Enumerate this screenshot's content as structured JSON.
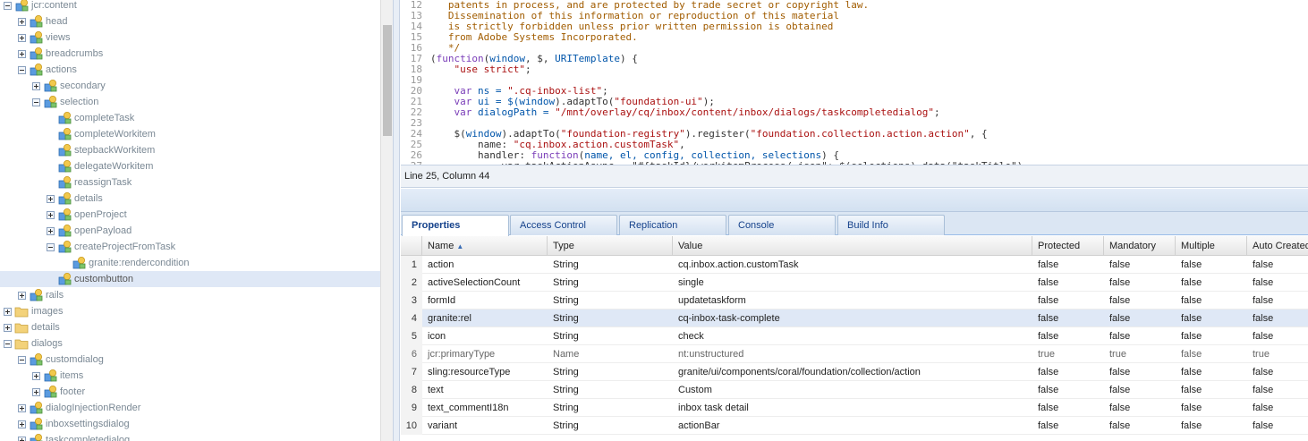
{
  "tree": {
    "nodes": [
      {
        "label": "jcr:content",
        "depth": 0,
        "expander": "minus",
        "icon": "node"
      },
      {
        "label": "head",
        "depth": 1,
        "expander": "plus",
        "icon": "node"
      },
      {
        "label": "views",
        "depth": 1,
        "expander": "plus",
        "icon": "node"
      },
      {
        "label": "breadcrumbs",
        "depth": 1,
        "expander": "plus",
        "icon": "node"
      },
      {
        "label": "actions",
        "depth": 1,
        "expander": "minus",
        "icon": "node"
      },
      {
        "label": "secondary",
        "depth": 2,
        "expander": "plus",
        "icon": "node"
      },
      {
        "label": "selection",
        "depth": 2,
        "expander": "minus",
        "icon": "node"
      },
      {
        "label": "completeTask",
        "depth": 3,
        "expander": "none",
        "icon": "node"
      },
      {
        "label": "completeWorkitem",
        "depth": 3,
        "expander": "none",
        "icon": "node"
      },
      {
        "label": "stepbackWorkitem",
        "depth": 3,
        "expander": "none",
        "icon": "node"
      },
      {
        "label": "delegateWorkitem",
        "depth": 3,
        "expander": "none",
        "icon": "node"
      },
      {
        "label": "reassignTask",
        "depth": 3,
        "expander": "none",
        "icon": "node"
      },
      {
        "label": "details",
        "depth": 3,
        "expander": "plus",
        "icon": "node"
      },
      {
        "label": "openProject",
        "depth": 3,
        "expander": "plus",
        "icon": "node"
      },
      {
        "label": "openPayload",
        "depth": 3,
        "expander": "plus",
        "icon": "node"
      },
      {
        "label": "createProjectFromTask",
        "depth": 3,
        "expander": "minus",
        "icon": "node"
      },
      {
        "label": "granite:rendercondition",
        "depth": 4,
        "expander": "none",
        "icon": "node"
      },
      {
        "label": "custombutton",
        "depth": 3,
        "expander": "none",
        "icon": "node",
        "selected": true
      },
      {
        "label": "rails",
        "depth": 1,
        "expander": "plus",
        "icon": "node"
      },
      {
        "label": "images",
        "depth": 0,
        "expander": "plus",
        "icon": "folder"
      },
      {
        "label": "details",
        "depth": 0,
        "expander": "plus",
        "icon": "folder"
      },
      {
        "label": "dialogs",
        "depth": 0,
        "expander": "minus",
        "icon": "folder"
      },
      {
        "label": "customdialog",
        "depth": 1,
        "expander": "minus",
        "icon": "node"
      },
      {
        "label": "items",
        "depth": 2,
        "expander": "plus",
        "icon": "node"
      },
      {
        "label": "footer",
        "depth": 2,
        "expander": "plus",
        "icon": "node"
      },
      {
        "label": "dialogInjectionRender",
        "depth": 1,
        "expander": "plus",
        "icon": "node"
      },
      {
        "label": "inboxsettingsdialog",
        "depth": 1,
        "expander": "plus",
        "icon": "node"
      },
      {
        "label": "taskcompletedialog",
        "depth": 1,
        "expander": "plus",
        "icon": "node"
      }
    ]
  },
  "editor": {
    "lines": [
      {
        "n": "12",
        "parts": [
          {
            "t": "   patents in process, and are protected by trade secret or copyright law.",
            "c": "cm"
          }
        ]
      },
      {
        "n": "13",
        "parts": [
          {
            "t": "   Dissemination of this information or reproduction of this material",
            "c": "cm"
          }
        ]
      },
      {
        "n": "14",
        "parts": [
          {
            "t": "   is strictly forbidden unless prior written permission is obtained",
            "c": "cm"
          }
        ]
      },
      {
        "n": "15",
        "parts": [
          {
            "t": "   from Adobe Systems Incorporated.",
            "c": "cm"
          }
        ]
      },
      {
        "n": "16",
        "parts": [
          {
            "t": "   */",
            "c": "cm"
          }
        ]
      },
      {
        "n": "17",
        "parts": [
          {
            "t": "(",
            "c": ""
          },
          {
            "t": "function",
            "c": "kw"
          },
          {
            "t": "(",
            "c": ""
          },
          {
            "t": "window",
            "c": "nm"
          },
          {
            "t": ", $, ",
            "c": ""
          },
          {
            "t": "URITemplate",
            "c": "nm"
          },
          {
            "t": ") {",
            "c": ""
          }
        ]
      },
      {
        "n": "18",
        "parts": [
          {
            "t": "    ",
            "c": ""
          },
          {
            "t": "\"use strict\"",
            "c": "str"
          },
          {
            "t": ";",
            "c": ""
          }
        ]
      },
      {
        "n": "19",
        "parts": [
          {
            "t": "",
            "c": ""
          }
        ]
      },
      {
        "n": "20",
        "parts": [
          {
            "t": "    ",
            "c": ""
          },
          {
            "t": "var",
            "c": "kw"
          },
          {
            "t": " ns = ",
            "c": "nm"
          },
          {
            "t": "\".cq-inbox-list\"",
            "c": "str"
          },
          {
            "t": ";",
            "c": ""
          }
        ]
      },
      {
        "n": "21",
        "parts": [
          {
            "t": "    ",
            "c": ""
          },
          {
            "t": "var",
            "c": "kw"
          },
          {
            "t": " ui = $(",
            "c": "nm"
          },
          {
            "t": "window",
            "c": "nm"
          },
          {
            "t": ").adaptTo(",
            "c": ""
          },
          {
            "t": "\"foundation-ui\"",
            "c": "str"
          },
          {
            "t": ");",
            "c": ""
          }
        ]
      },
      {
        "n": "22",
        "parts": [
          {
            "t": "    ",
            "c": ""
          },
          {
            "t": "var",
            "c": "kw"
          },
          {
            "t": " dialogPath = ",
            "c": "nm"
          },
          {
            "t": "\"/mnt/overlay/cq/inbox/content/inbox/dialogs/taskcompletedialog\"",
            "c": "str"
          },
          {
            "t": ";",
            "c": ""
          }
        ]
      },
      {
        "n": "23",
        "parts": [
          {
            "t": "",
            "c": ""
          }
        ]
      },
      {
        "n": "24",
        "parts": [
          {
            "t": "    $(",
            "c": ""
          },
          {
            "t": "window",
            "c": "nm"
          },
          {
            "t": ").adaptTo(",
            "c": ""
          },
          {
            "t": "\"foundation-registry\"",
            "c": "str"
          },
          {
            "t": ").register(",
            "c": ""
          },
          {
            "t": "\"foundation.collection.action.action\"",
            "c": "str"
          },
          {
            "t": ", {",
            "c": ""
          }
        ]
      },
      {
        "n": "25",
        "parts": [
          {
            "t": "        name: ",
            "c": ""
          },
          {
            "t": "\"cq.inbox.action.customTask\"",
            "c": "str"
          },
          {
            "t": ",",
            "c": ""
          }
        ]
      },
      {
        "n": "26",
        "parts": [
          {
            "t": "        handler: ",
            "c": ""
          },
          {
            "t": "function",
            "c": "kw"
          },
          {
            "t": "(",
            "c": ""
          },
          {
            "t": "name, el, config, collection, selections",
            "c": "nm"
          },
          {
            "t": ") {",
            "c": ""
          }
        ]
      },
      {
        "n": "27",
        "parts": [
          {
            "t": "            var taskActionAsync = \"#{taskId}/workitemProcess/.json\"; $(selections).data(\"taskTitle\")",
            "c": ""
          }
        ]
      }
    ]
  },
  "status": {
    "position": "Line 25, Column 44"
  },
  "tabs": [
    "Properties",
    "Access Control",
    "Replication",
    "Console",
    "Build Info"
  ],
  "grid": {
    "columns": [
      "Name",
      "Type",
      "Value",
      "Protected",
      "Mandatory",
      "Multiple",
      "Auto Created"
    ],
    "rows": [
      {
        "n": "1",
        "name": "action",
        "type": "String",
        "value": "cq.inbox.action.customTask",
        "protected": "false",
        "mandatory": "false",
        "multiple": "false",
        "auto": "false"
      },
      {
        "n": "2",
        "name": "activeSelectionCount",
        "type": "String",
        "value": "single",
        "protected": "false",
        "mandatory": "false",
        "multiple": "false",
        "auto": "false"
      },
      {
        "n": "3",
        "name": "formId",
        "type": "String",
        "value": "updatetaskform",
        "protected": "false",
        "mandatory": "false",
        "multiple": "false",
        "auto": "false"
      },
      {
        "n": "4",
        "name": "granite:rel",
        "type": "String",
        "value": "cq-inbox-task-complete",
        "protected": "false",
        "mandatory": "false",
        "multiple": "false",
        "auto": "false",
        "selected": true
      },
      {
        "n": "5",
        "name": "icon",
        "type": "String",
        "value": "check",
        "protected": "false",
        "mandatory": "false",
        "multiple": "false",
        "auto": "false"
      },
      {
        "n": "6",
        "name": "jcr:primaryType",
        "type": "Name",
        "value": "nt:unstructured",
        "protected": "true",
        "mandatory": "true",
        "multiple": "false",
        "auto": "true",
        "dim": true
      },
      {
        "n": "7",
        "name": "sling:resourceType",
        "type": "String",
        "value": "granite/ui/components/coral/foundation/collection/action",
        "protected": "false",
        "mandatory": "false",
        "multiple": "false",
        "auto": "false"
      },
      {
        "n": "8",
        "name": "text",
        "type": "String",
        "value": "Custom",
        "protected": "false",
        "mandatory": "false",
        "multiple": "false",
        "auto": "false"
      },
      {
        "n": "9",
        "name": "text_commentI18n",
        "type": "String",
        "value": "inbox task detail",
        "protected": "false",
        "mandatory": "false",
        "multiple": "false",
        "auto": "false"
      },
      {
        "n": "10",
        "name": "variant",
        "type": "String",
        "value": "actionBar",
        "protected": "false",
        "mandatory": "false",
        "multiple": "false",
        "auto": "false"
      }
    ]
  }
}
